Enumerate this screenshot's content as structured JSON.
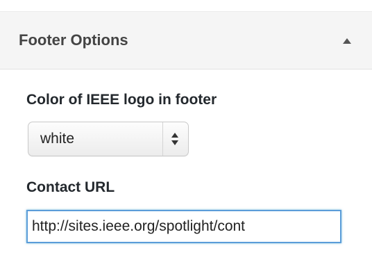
{
  "panel": {
    "title": "Footer Options",
    "toggle_icon": "triangle-up-icon"
  },
  "fields": {
    "logo_color": {
      "label": "Color of IEEE logo in footer",
      "selected": "white",
      "arrow_icon": "up-down-arrows-icon"
    },
    "contact_url": {
      "label": "Contact URL",
      "value": "http://sites.ieee.org/spotlight/cont"
    }
  },
  "colors": {
    "focus_border": "#5b9dd9",
    "header_background": "#f5f5f5"
  }
}
